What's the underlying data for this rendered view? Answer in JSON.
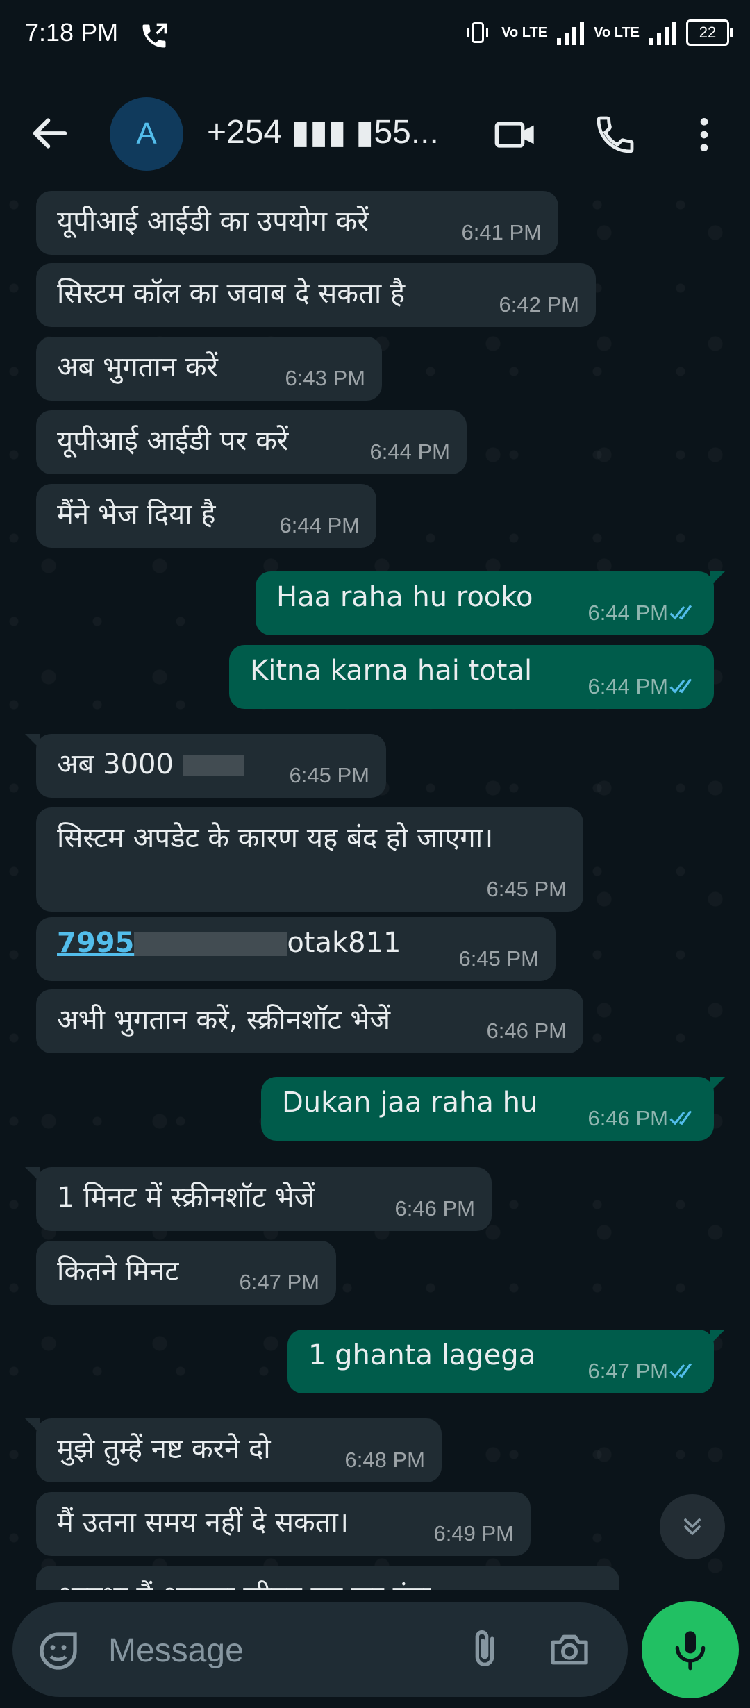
{
  "status_bar": {
    "time": "7:18 PM",
    "network": "Vo LTE",
    "battery": "22"
  },
  "header": {
    "avatar_letter": "A",
    "contact": "+254 ▮▮▮ ▮55..."
  },
  "messages": [
    {
      "dir": "in",
      "text": "यूपीआई आईडी का उपयोग करें",
      "time": "6:41 PM"
    },
    {
      "dir": "in",
      "text": "सिस्टम कॉल का जवाब दे सकता है",
      "time": "6:42 PM"
    },
    {
      "dir": "in",
      "text": "अब भुगतान करें",
      "time": "6:43 PM"
    },
    {
      "dir": "in",
      "text": "यूपीआई आईडी पर करें",
      "time": "6:44 PM"
    },
    {
      "dir": "in",
      "text": "मैंने भेज दिया है",
      "time": "6:44 PM"
    },
    {
      "dir": "out",
      "text": "Haa raha hu rooko",
      "time": "6:44 PM"
    },
    {
      "dir": "out",
      "text": "Kitna karna hai total",
      "time": "6:44 PM"
    },
    {
      "dir": "in",
      "text": "अब 3000",
      "time": "6:45 PM"
    },
    {
      "dir": "in",
      "text": "सिस्टम अपडेट के कारण यह बंद हो जाएगा।",
      "time": "6:45 PM"
    },
    {
      "dir": "in",
      "text_link_start": "7995",
      "text_link_end": "otak811",
      "time": "6:45 PM"
    },
    {
      "dir": "in",
      "text": "अभी भुगतान करें, स्क्रीनशॉट भेजें",
      "time": "6:46 PM"
    },
    {
      "dir": "out",
      "text": "Dukan jaa raha hu",
      "time": "6:46 PM"
    },
    {
      "dir": "in",
      "text": "1 मिनट में स्क्रीनशॉट भेजें",
      "time": "6:46 PM"
    },
    {
      "dir": "in",
      "text": "कितने मिनट",
      "time": "6:47 PM"
    },
    {
      "dir": "out",
      "text": "1 ghanta lagega",
      "time": "6:47 PM"
    },
    {
      "dir": "in",
      "text": "मुझे तुम्हें नष्ट करने दो",
      "time": "6:48 PM"
    },
    {
      "dir": "in",
      "text": "मैं उतना समय नहीं दे सकता।",
      "time": "6:49 PM"
    },
    {
      "dir": "in",
      "text": "अन्यथा मैं आपका जीवन नष्ट कर दूंगा",
      "time": ""
    }
  ],
  "input": {
    "placeholder": "Message"
  },
  "colors": {
    "bg": "#0b141a",
    "incoming": "#202c33",
    "outgoing": "#005c4b",
    "read_ticks": "#53bdeb",
    "mic": "#21c063"
  }
}
